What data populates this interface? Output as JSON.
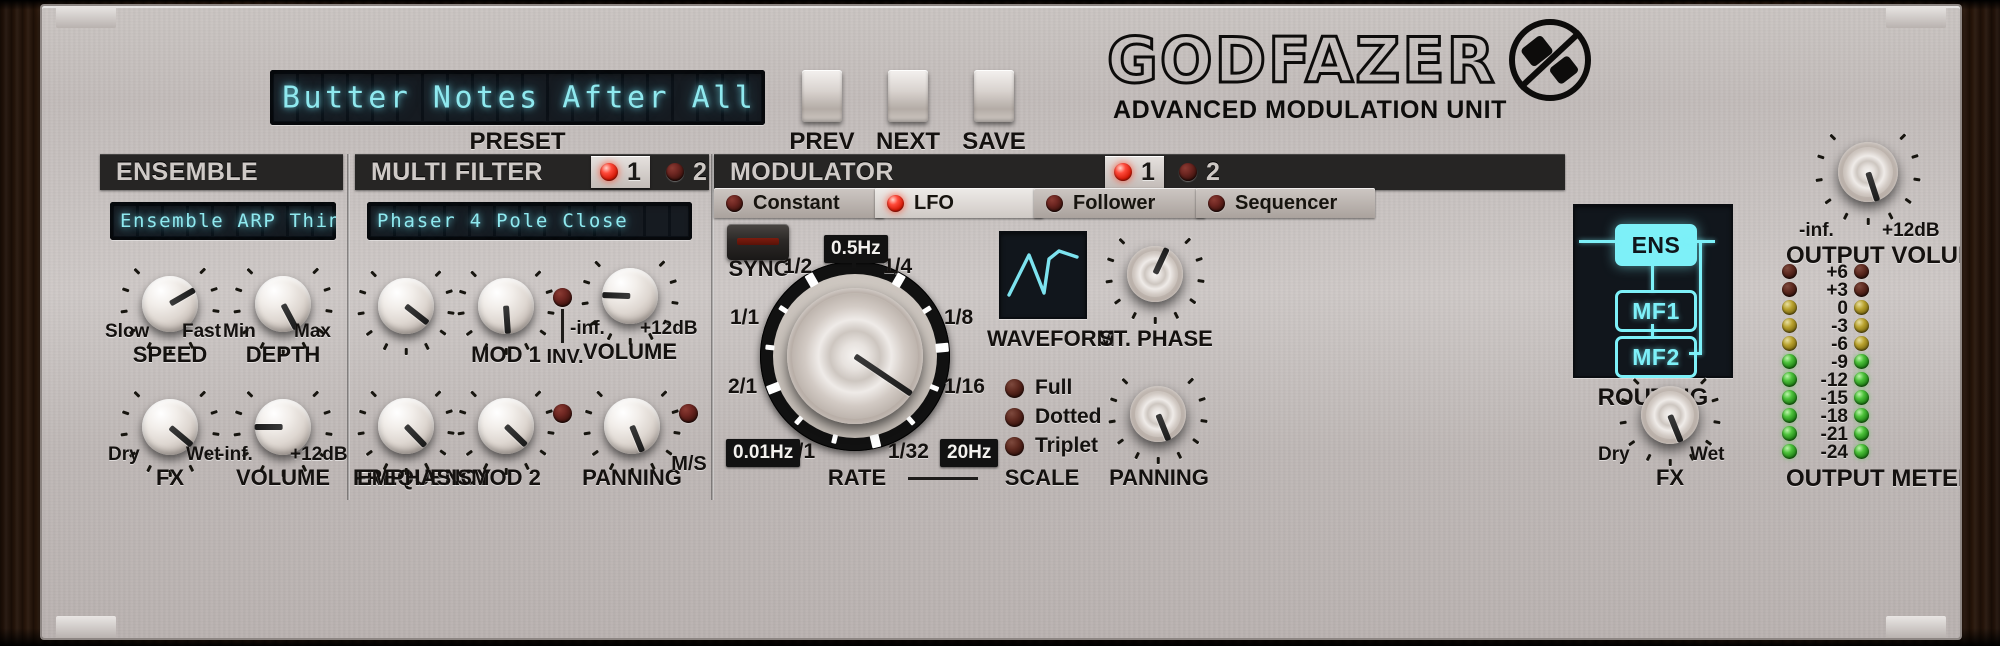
{
  "brand": {
    "name": "GODFAZER",
    "tagline": "ADVANCED MODULATION UNIT",
    "logo_icon": "crossed-circle-logo-icon"
  },
  "preset": {
    "display_value": "Butter Notes After All",
    "label": "PRESET",
    "buttons": [
      {
        "name": "prev",
        "label": "PREV"
      },
      {
        "name": "next",
        "label": "NEXT"
      },
      {
        "name": "save",
        "label": "SAVE"
      }
    ]
  },
  "ensemble": {
    "title": "ENSEMBLE",
    "display_value": "Ensemble ARP Thin",
    "knobs": [
      {
        "name": "SPEED",
        "min_label": "Slow",
        "max_label": "Fast",
        "angle": -120
      },
      {
        "name": "DEPTH",
        "min_label": "Min",
        "max_label": "Max",
        "angle": -28
      },
      {
        "name": "FX",
        "min_label": "Dry",
        "max_label": "Wet",
        "angle": -50
      },
      {
        "name": "VOLUME",
        "min_label": "-inf.",
        "max_label": "+12dB",
        "angle": 90
      }
    ]
  },
  "multi_filter": {
    "title": "MULTI FILTER",
    "display_value": "Phaser 4 Pole Close",
    "selectors": [
      {
        "label": "1",
        "selected": true
      },
      {
        "label": "2",
        "selected": false
      }
    ],
    "knobs": [
      {
        "name": "FREQUENCY",
        "angle": -52
      },
      {
        "name": "MOD 1",
        "angle": -4
      },
      {
        "name": "VOLUME",
        "min_label": "-inf.",
        "max_label": "+12dB",
        "angle": 92
      },
      {
        "name": "EMPHASIS",
        "angle": -44
      },
      {
        "name": "MOD 2",
        "angle": -46
      },
      {
        "name": "PANNING",
        "angle": -22
      }
    ],
    "toggles": [
      {
        "name": "INV.",
        "label": "INV.",
        "on": false
      },
      {
        "name": "M/S",
        "label": "M/S",
        "on": false
      }
    ]
  },
  "modulator": {
    "title": "MODULATOR",
    "selectors": [
      {
        "label": "1",
        "selected": true
      },
      {
        "label": "2",
        "selected": false
      }
    ],
    "tabs": [
      {
        "label": "Constant",
        "active": false
      },
      {
        "label": "LFO",
        "active": true
      },
      {
        "label": "Follower",
        "active": false
      },
      {
        "label": "Sequencer",
        "active": false
      }
    ],
    "sync": {
      "label": "SYNC",
      "on": true
    },
    "rate": {
      "label": "RATE",
      "value_badge": "0.5Hz",
      "min_badge": "0.01Hz",
      "max_badge": "20Hz",
      "angle": -56,
      "division_labels": [
        "1/2",
        "1/4",
        "1/1",
        "1/8",
        "2/1",
        "1/16",
        "4/1",
        "1/32"
      ]
    },
    "waveform": {
      "label": "WAVEFORM",
      "shape": "triangle-saw-waveform-icon",
      "color": "#7de3ef"
    },
    "st_phase": {
      "name": "ST. PHASE",
      "angle": -155
    },
    "panning": {
      "name": "PANNING",
      "angle": -22
    },
    "scale": {
      "label": "SCALE",
      "options": [
        {
          "label": "Full",
          "selected": false
        },
        {
          "label": "Dotted",
          "selected": false
        },
        {
          "label": "Triplet",
          "selected": false
        }
      ]
    }
  },
  "routing": {
    "label": "ROUTING",
    "nodes": [
      {
        "label": "ENS",
        "filled": true
      },
      {
        "label": "MF1",
        "filled": false
      },
      {
        "label": "MF2",
        "filled": false
      }
    ]
  },
  "output": {
    "volume": {
      "name": "OUTPUT VOLUME",
      "min_label": "-inf.",
      "max_label": "+12dB",
      "angle": -18
    },
    "fx": {
      "name": "FX",
      "min_label": "Dry",
      "max_label": "Wet",
      "angle": -22
    },
    "meter": {
      "label": "OUTPUT METER",
      "scale": [
        "+6",
        "+3",
        "0",
        "-3",
        "-6",
        "-9",
        "-12",
        "-15",
        "-18",
        "-21",
        "-24"
      ],
      "colors": [
        "dred",
        "dred",
        "yel",
        "yel",
        "yel",
        "grn",
        "grn",
        "grn",
        "grn",
        "grn",
        "grn"
      ]
    }
  },
  "colors": {
    "lcd_text": "#8fe9ef",
    "routing_accent": "#7df0f8",
    "led_on": "#ff4a3a",
    "panel": "#cbc4c1"
  }
}
